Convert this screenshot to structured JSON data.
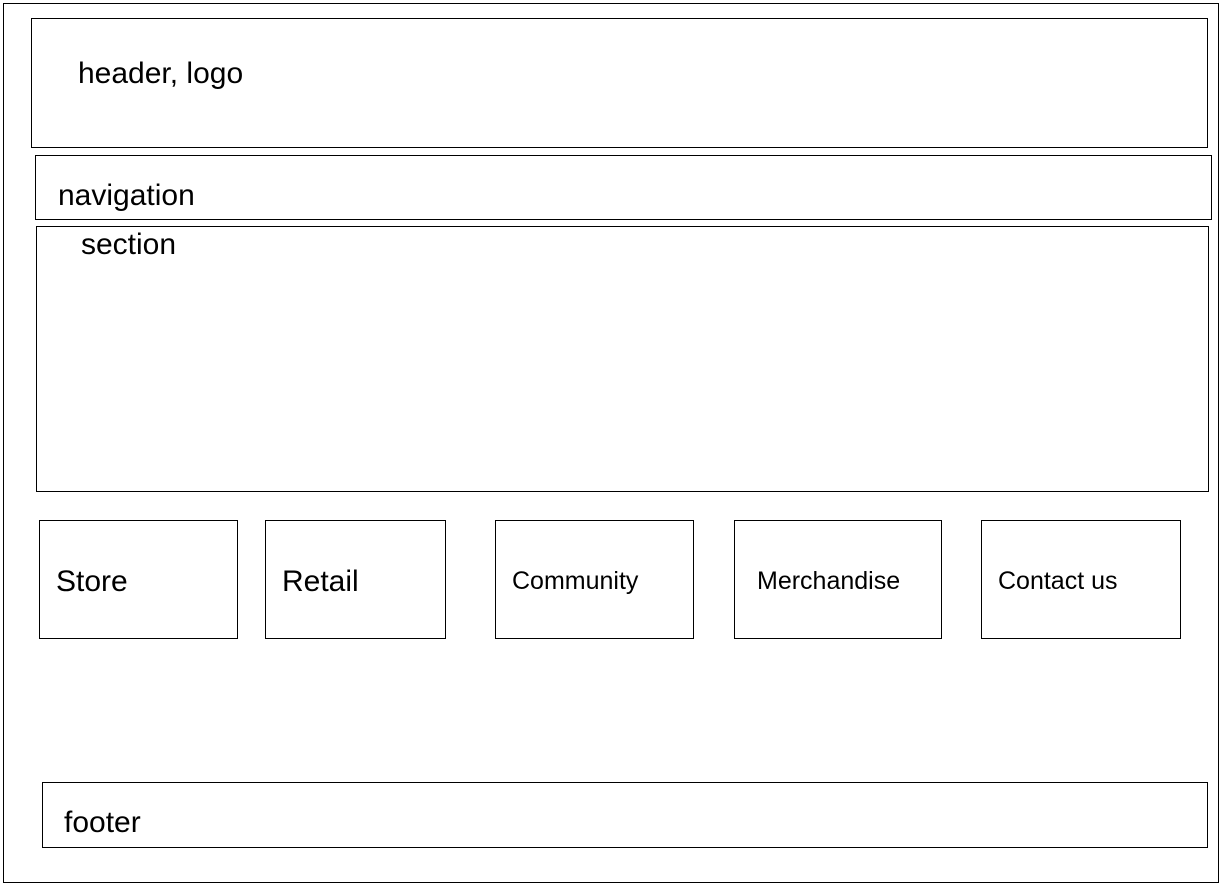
{
  "wireframe": {
    "header": {
      "label": "header, logo"
    },
    "navigation": {
      "label": "navigation"
    },
    "section": {
      "label": "section"
    },
    "tiles": [
      {
        "label": "Store"
      },
      {
        "label": "Retail"
      },
      {
        "label": "Community"
      },
      {
        "label": "Merchandise"
      },
      {
        "label": "Contact us"
      }
    ],
    "footer": {
      "label": "footer"
    }
  }
}
